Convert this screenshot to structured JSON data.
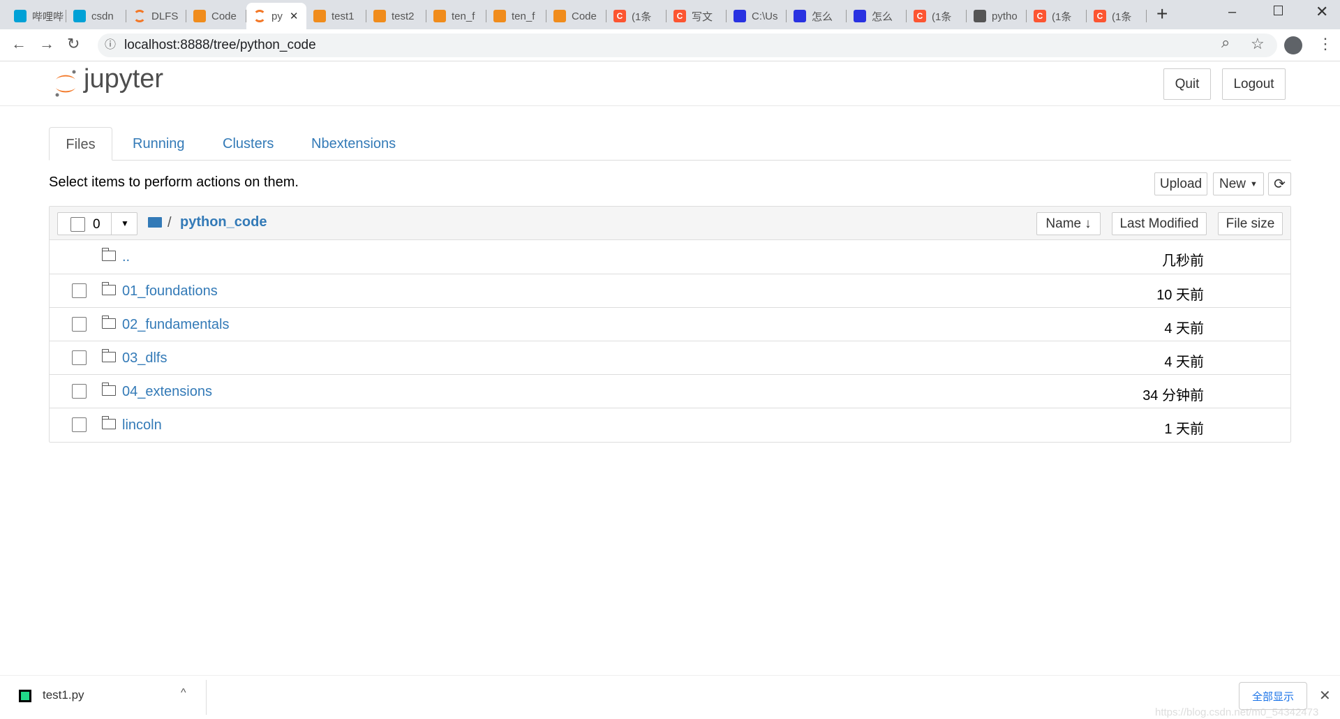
{
  "browser": {
    "tabs": [
      {
        "label": "哔哩哔",
        "icon": "bilibili-icon",
        "color": "#00a1d6"
      },
      {
        "label": "csdn",
        "icon": "bilibili-icon",
        "color": "#00a1d6"
      },
      {
        "label": "DLFS",
        "icon": "jupyter-icon",
        "color": "#f37726"
      },
      {
        "label": "Code",
        "icon": "book-icon",
        "color": "#f08c1c"
      },
      {
        "label": "py",
        "icon": "jupyter-icon",
        "color": "#f37726",
        "active": true
      },
      {
        "label": "test1",
        "icon": "file-icon",
        "color": "#f08c1c"
      },
      {
        "label": "test2",
        "icon": "book-icon",
        "color": "#f08c1c"
      },
      {
        "label": "ten_f",
        "icon": "book-icon",
        "color": "#f08c1c"
      },
      {
        "label": "ten_f",
        "icon": "book-icon",
        "color": "#f08c1c"
      },
      {
        "label": "Code",
        "icon": "book-icon",
        "color": "#f08c1c"
      },
      {
        "label": "(1条",
        "icon": "csdn-icon",
        "color": "#fc5531"
      },
      {
        "label": "写文",
        "icon": "csdn-icon",
        "color": "#fc5531"
      },
      {
        "label": "C:\\Us",
        "icon": "baidu-icon",
        "color": "#2932e1"
      },
      {
        "label": "怎么",
        "icon": "baidu-icon",
        "color": "#2932e1"
      },
      {
        "label": "怎么",
        "icon": "baidu-icon",
        "color": "#2932e1"
      },
      {
        "label": "(1条",
        "icon": "csdn-icon",
        "color": "#fc5531"
      },
      {
        "label": "pytho",
        "icon": "python-icon",
        "color": "#555555"
      },
      {
        "label": "(1条",
        "icon": "csdn-icon",
        "color": "#fc5531"
      },
      {
        "label": "(1条",
        "icon": "csdn-icon",
        "color": "#fc5531"
      }
    ],
    "url": "localhost:8888/tree/python_code"
  },
  "header": {
    "logo_text": "jupyter",
    "quit": "Quit",
    "logout": "Logout"
  },
  "nav_tabs": [
    "Files",
    "Running",
    "Clusters",
    "Nbextensions"
  ],
  "toolbar": {
    "hint": "Select items to perform actions on them.",
    "upload": "Upload",
    "new": "New"
  },
  "list": {
    "selected_count": "0",
    "breadcrumb_sep": "/",
    "current_dir": "python_code",
    "columns": {
      "name": "Name",
      "last_modified": "Last Modified",
      "file_size": "File size"
    },
    "parent": {
      "name": "..",
      "modified": "几秒前"
    },
    "rows": [
      {
        "name": "01_foundations",
        "modified": "10 天前"
      },
      {
        "name": "02_fundamentals",
        "modified": "4 天前"
      },
      {
        "name": "03_dlfs",
        "modified": "4 天前"
      },
      {
        "name": "04_extensions",
        "modified": "34 分钟前"
      },
      {
        "name": "lincoln",
        "modified": "1 天前"
      }
    ]
  },
  "downloads": {
    "file": "test1.py",
    "show_all": "全部显示",
    "watermark": "https://blog.csdn.net/m0_54342473"
  }
}
